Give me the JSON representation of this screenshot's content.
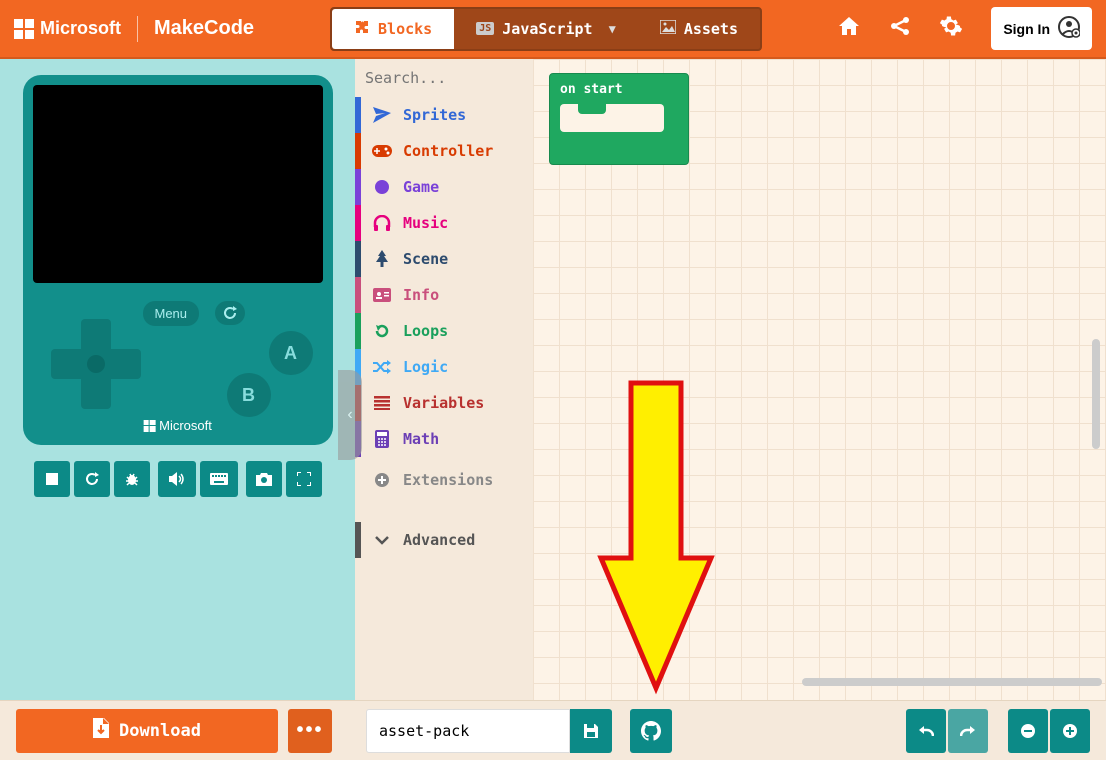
{
  "header": {
    "ms": "Microsoft",
    "brand": "MakeCode",
    "tabs": {
      "blocks": "Blocks",
      "js": "JavaScript",
      "assets": "Assets"
    },
    "signin": "Sign In"
  },
  "sim": {
    "menu": "Menu",
    "a": "A",
    "b": "B",
    "footer": "Microsoft"
  },
  "search": {
    "placeholder": "Search..."
  },
  "categories": {
    "sprites": "Sprites",
    "controller": "Controller",
    "game": "Game",
    "music": "Music",
    "scene": "Scene",
    "info": "Info",
    "loops": "Loops",
    "logic": "Logic",
    "variables": "Variables",
    "math": "Math",
    "extensions": "Extensions",
    "advanced": "Advanced"
  },
  "workspace": {
    "block": "on start"
  },
  "bottom": {
    "download": "Download",
    "project_name": "asset-pack"
  }
}
